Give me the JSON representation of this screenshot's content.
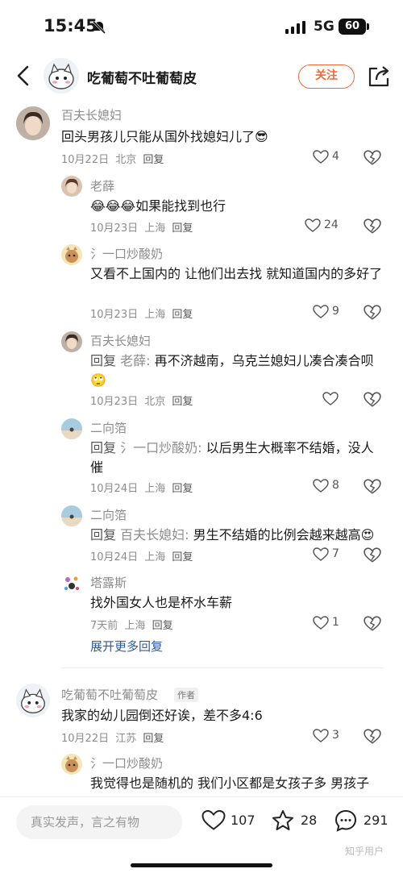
{
  "status": {
    "time": "15:45",
    "network": "5G",
    "battery": "60"
  },
  "header": {
    "title": "吃葡萄不吐葡萄皮",
    "follow_label": "关注"
  },
  "comments": [
    {
      "name": "百夫长媳妇",
      "text": "回头男孩儿只能从国外找媳妇儿了😎",
      "date": "10月22日",
      "location": "北京",
      "reply": "回复",
      "likes": "4"
    },
    {
      "name": "老薛",
      "text": "😂😂😂如果能找到也行",
      "date": "10月23日",
      "location": "上海",
      "reply": "回复",
      "likes": "24"
    },
    {
      "name": "氵一口炒酸奶",
      "text": "又看不上国内的 让他们出去找 就知道国内的多好了",
      "date": "10月23日",
      "location": "上海",
      "reply": "回复",
      "likes": "9"
    },
    {
      "name": "百夫长媳妇",
      "reply_prefix": "回复",
      "reply_to": "老薛:",
      "text": "再不济越南，乌克兰媳妇儿凑合凑合呗🙄",
      "date": "10月23日",
      "location": "北京",
      "reply": "回复",
      "likes": ""
    },
    {
      "name": "二向箔",
      "reply_prefix": "回复",
      "reply_to": "氵一口炒酸奶:",
      "text": "以后男生大概率不结婚，没人催",
      "date": "10月24日",
      "location": "上海",
      "reply": "回复",
      "likes": "8"
    },
    {
      "name": "二向箔",
      "reply_prefix": "回复",
      "reply_to": "百夫长媳妇:",
      "text": "男生不结婚的比例会越来越高😍",
      "date": "10月24日",
      "location": "上海",
      "reply": "回复",
      "likes": "7"
    },
    {
      "name": "塔露斯",
      "text": "找外国女人也是杯水车薪",
      "date": "7天前",
      "location": "上海",
      "reply": "回复",
      "likes": "1"
    },
    {
      "name": "吃葡萄不吐葡萄皮",
      "badge": "作者",
      "text": "我家的幼儿园倒还好诶，差不多4:6",
      "date": "10月22日",
      "location": "江苏",
      "reply": "回复",
      "likes": "3"
    },
    {
      "name": "氵一口炒酸奶",
      "text": "我觉得也是随机的 我们小区都是女孩子多 男孩子"
    }
  ],
  "expand_label": "展开更多回复",
  "bottom": {
    "placeholder": "真实发声，言之有物",
    "likes": "107",
    "stars": "28",
    "comments": "291",
    "watermark": "知乎用户"
  },
  "colors": {
    "accent": "#f06a3a",
    "link": "#2a5b9e",
    "meta": "#8c8c8c"
  }
}
